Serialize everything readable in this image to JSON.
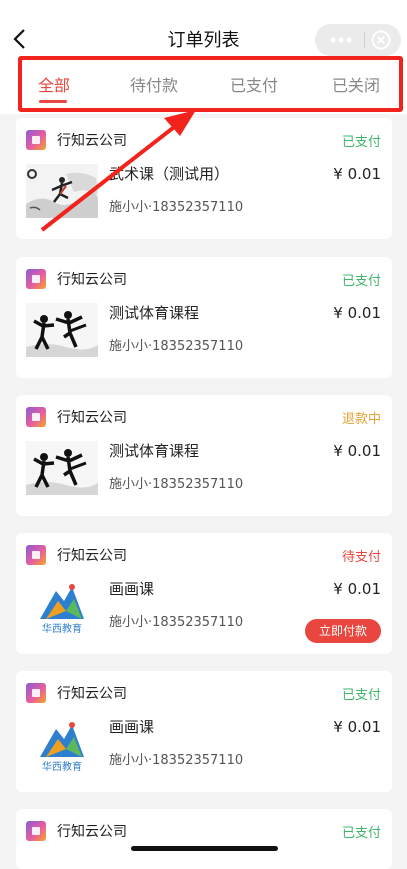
{
  "header": {
    "title": "订单列表",
    "back_icon": "chevron-left-icon"
  },
  "capsule": {
    "more_icon": "more-dots-icon",
    "close_icon": "close-circle-icon"
  },
  "tabs": [
    {
      "label": "全部",
      "active": true
    },
    {
      "label": "待付款",
      "active": false
    },
    {
      "label": "已支付",
      "active": false
    },
    {
      "label": "已关闭",
      "active": false
    }
  ],
  "orders": [
    {
      "shop": "行知云公司",
      "status": "已支付",
      "status_color": "#3fb56b",
      "course": "武术课（测试用）",
      "price": "¥ 0.01",
      "buyer": "施小小·18352357110",
      "thumb": "martial-arts-ink-image"
    },
    {
      "shop": "行知云公司",
      "status": "已支付",
      "status_color": "#3fb56b",
      "course": "测试体育课程",
      "price": "¥ 0.01",
      "buyer": "施小小·18352357110",
      "thumb": "kick-silhouette-image"
    },
    {
      "shop": "行知云公司",
      "status": "退款中",
      "status_color": "#e8a23a",
      "course": "测试体育课程",
      "price": "¥ 0.01",
      "buyer": "施小小·18352357110",
      "thumb": "kick-silhouette-image"
    },
    {
      "shop": "行知云公司",
      "status": "待支付",
      "status_color": "#e8463e",
      "course": "画画课",
      "price": "¥ 0.01",
      "buyer": "施小小·18352357110",
      "thumb": "huaxi-education-logo",
      "logo_text": "华西教育",
      "pay_label": "立即付款"
    },
    {
      "shop": "行知云公司",
      "status": "已支付",
      "status_color": "#3fb56b",
      "course": "画画课",
      "price": "¥ 0.01",
      "buyer": "施小小·18352357110",
      "thumb": "huaxi-education-logo",
      "logo_text": "华西教育"
    },
    {
      "shop": "行知云公司",
      "status": "已支付",
      "status_color": "#3fb56b"
    }
  ],
  "colors": {
    "accent": "#e8463e",
    "paid": "#3fb56b",
    "refunding": "#e8a23a",
    "annotation": "#f2231d"
  }
}
